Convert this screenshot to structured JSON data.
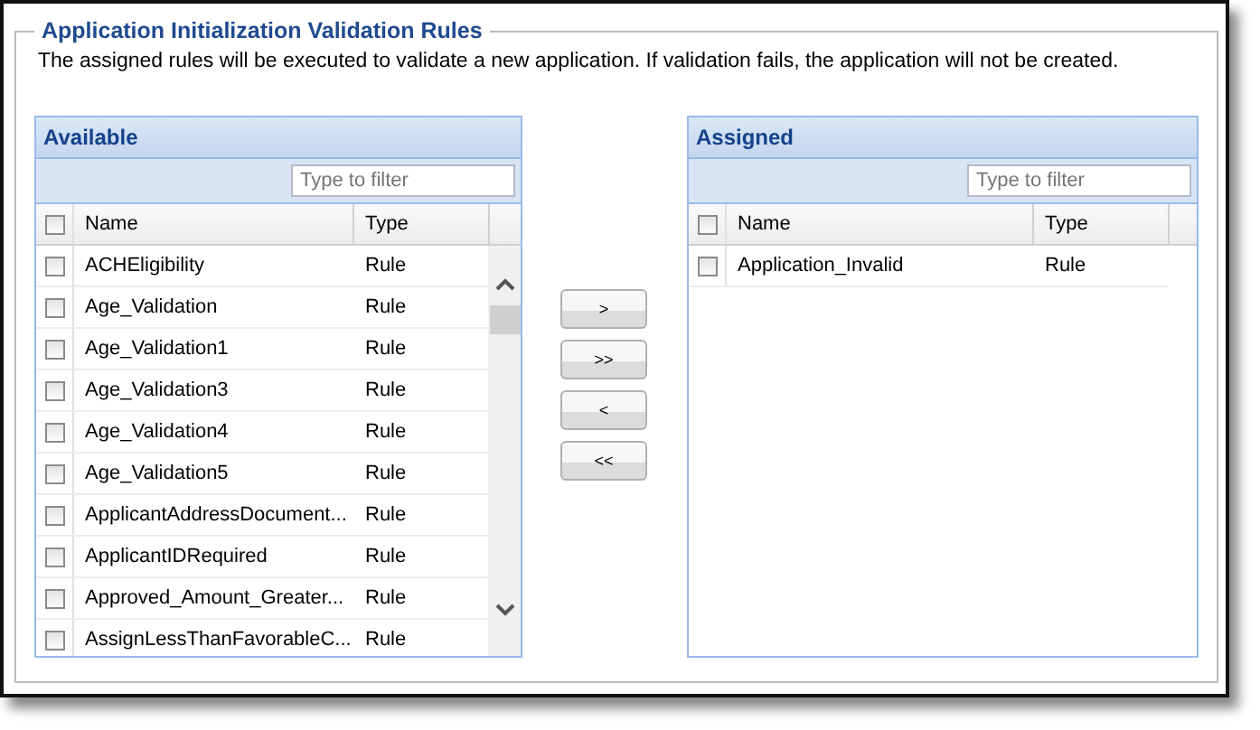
{
  "section": {
    "title": "Application Initialization Validation Rules",
    "description": "The assigned rules will be executed to validate a new application. If validation fails, the application will not be created."
  },
  "available": {
    "title": "Available",
    "filter": {
      "placeholder": "Type to filter"
    },
    "header_checked": false,
    "columns": [
      "Name",
      "Type"
    ],
    "rows": [
      {
        "name": "ACHEligibility",
        "type": "Rule",
        "checked": false
      },
      {
        "name": "Age_Validation",
        "type": "Rule",
        "checked": false
      },
      {
        "name": "Age_Validation1",
        "type": "Rule",
        "checked": false
      },
      {
        "name": "Age_Validation3",
        "type": "Rule",
        "checked": false
      },
      {
        "name": "Age_Validation4",
        "type": "Rule",
        "checked": false
      },
      {
        "name": "Age_Validation5",
        "type": "Rule",
        "checked": false
      },
      {
        "name": "ApplicantAddressDocument...",
        "type": "Rule",
        "checked": false
      },
      {
        "name": "ApplicantIDRequired",
        "type": "Rule",
        "checked": false
      },
      {
        "name": "Approved_Amount_Greater...",
        "type": "Rule",
        "checked": false
      },
      {
        "name": "AssignLessThanFavorableC...",
        "type": "Rule",
        "checked": false
      }
    ]
  },
  "move_buttons": [
    ">",
    ">>",
    "<",
    "<<"
  ],
  "assigned": {
    "title": "Assigned",
    "filter": {
      "placeholder": "Type to filter"
    },
    "header_checked": false,
    "columns": [
      "Name",
      "Type"
    ],
    "rows": [
      {
        "name": "Application_Invalid",
        "type": "Rule",
        "checked": false
      }
    ]
  }
}
